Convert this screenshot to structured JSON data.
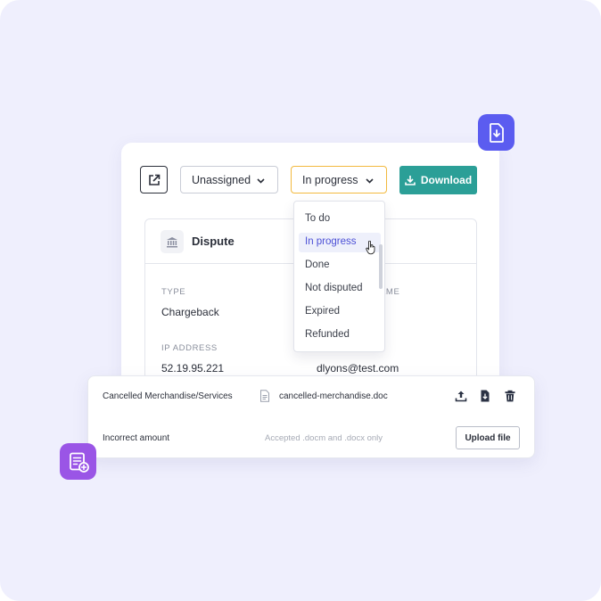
{
  "toolbar": {
    "assignee_value": "Unassigned",
    "status_value": "In progress",
    "download_label": "Download"
  },
  "status_menu": {
    "options": [
      "To do",
      "In progress",
      "Done",
      "Not disputed",
      "Expired",
      "Refunded"
    ],
    "selected": "In progress"
  },
  "dispute": {
    "title": "Dispute",
    "type_label": "TYPE",
    "type_value": "Chargeback",
    "partial_label": "AME",
    "ip_label": "IP ADDRESS",
    "ip_value": "52.19.95.221",
    "email_value": "dlyons@test.com"
  },
  "files": {
    "rows": [
      {
        "label": "Cancelled Merchandise/Services",
        "file_name": "cancelled-merchandise.doc"
      },
      {
        "label": "Incorrect amount",
        "hint": "Accepted .docm and .docx only",
        "upload_label": "Upload file"
      }
    ]
  },
  "icons": {
    "external_link": "external-link-icon",
    "chevron": "chevron-down-icon",
    "download": "download-icon",
    "bank": "bank-icon",
    "document": "document-icon",
    "upload": "upload-icon",
    "file_download": "file-download-icon",
    "trash": "trash-icon",
    "cursor": "hand-cursor-icon",
    "badge_top": "file-download-badge-icon",
    "badge_bottom": "note-add-badge-icon"
  },
  "colors": {
    "background": "#efeffd",
    "accent_teal": "#2b9f97",
    "focus_border": "#f2b93e",
    "selected_text": "#4b4fd6",
    "badge_blue": "#5b5cf0",
    "badge_purple": "#9a55e6"
  }
}
